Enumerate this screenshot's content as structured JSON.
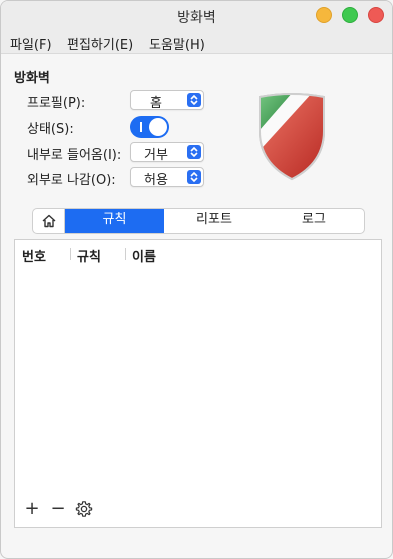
{
  "window": {
    "title": "방화벽"
  },
  "menubar": {
    "file": "파일(F)",
    "edit": "편집하기(E)",
    "help": "도움말(H)"
  },
  "firewall": {
    "section_title": "방화벽",
    "profile_label": "프로필(P):",
    "profile_value": "홈",
    "status_label": "상태(S):",
    "status_on": true,
    "incoming_label": "내부로 들어옴(I):",
    "incoming_value": "거부",
    "outgoing_label": "외부로 나감(O):",
    "outgoing_value": "허용"
  },
  "tabs": {
    "rules": "규칙",
    "report": "리포트",
    "log": "로그"
  },
  "table": {
    "columns": [
      "번호",
      "규칙",
      "이름"
    ]
  },
  "toolbar": {
    "add": "+",
    "remove": "−"
  },
  "colors": {
    "accent": "#1d6cf2"
  }
}
